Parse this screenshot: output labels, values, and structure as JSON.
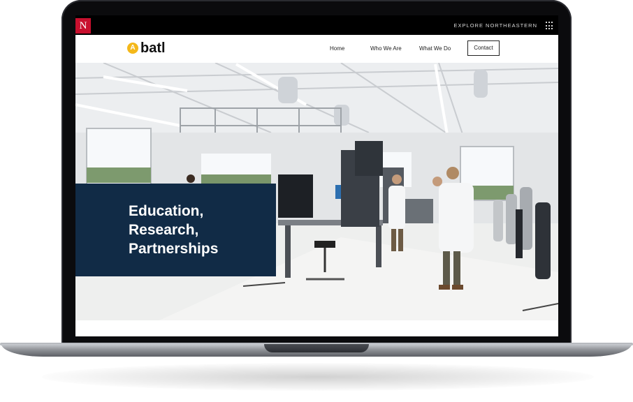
{
  "university_bar": {
    "logo_letter": "N",
    "explore_label": "EXPLORE NORTHEASTERN"
  },
  "site": {
    "brand_mark": "A",
    "brand_name": "batl"
  },
  "nav": {
    "items": [
      {
        "label": "Home"
      },
      {
        "label": "Who We Are"
      },
      {
        "label": "What We Do"
      }
    ],
    "contact_label": "Contact"
  },
  "hero": {
    "title_lines": [
      "Education,",
      "Research,",
      "Partnerships"
    ]
  },
  "colors": {
    "nu_red": "#c8102e",
    "brand_yellow": "#f4b81a",
    "hero_navy": "#112b46"
  }
}
